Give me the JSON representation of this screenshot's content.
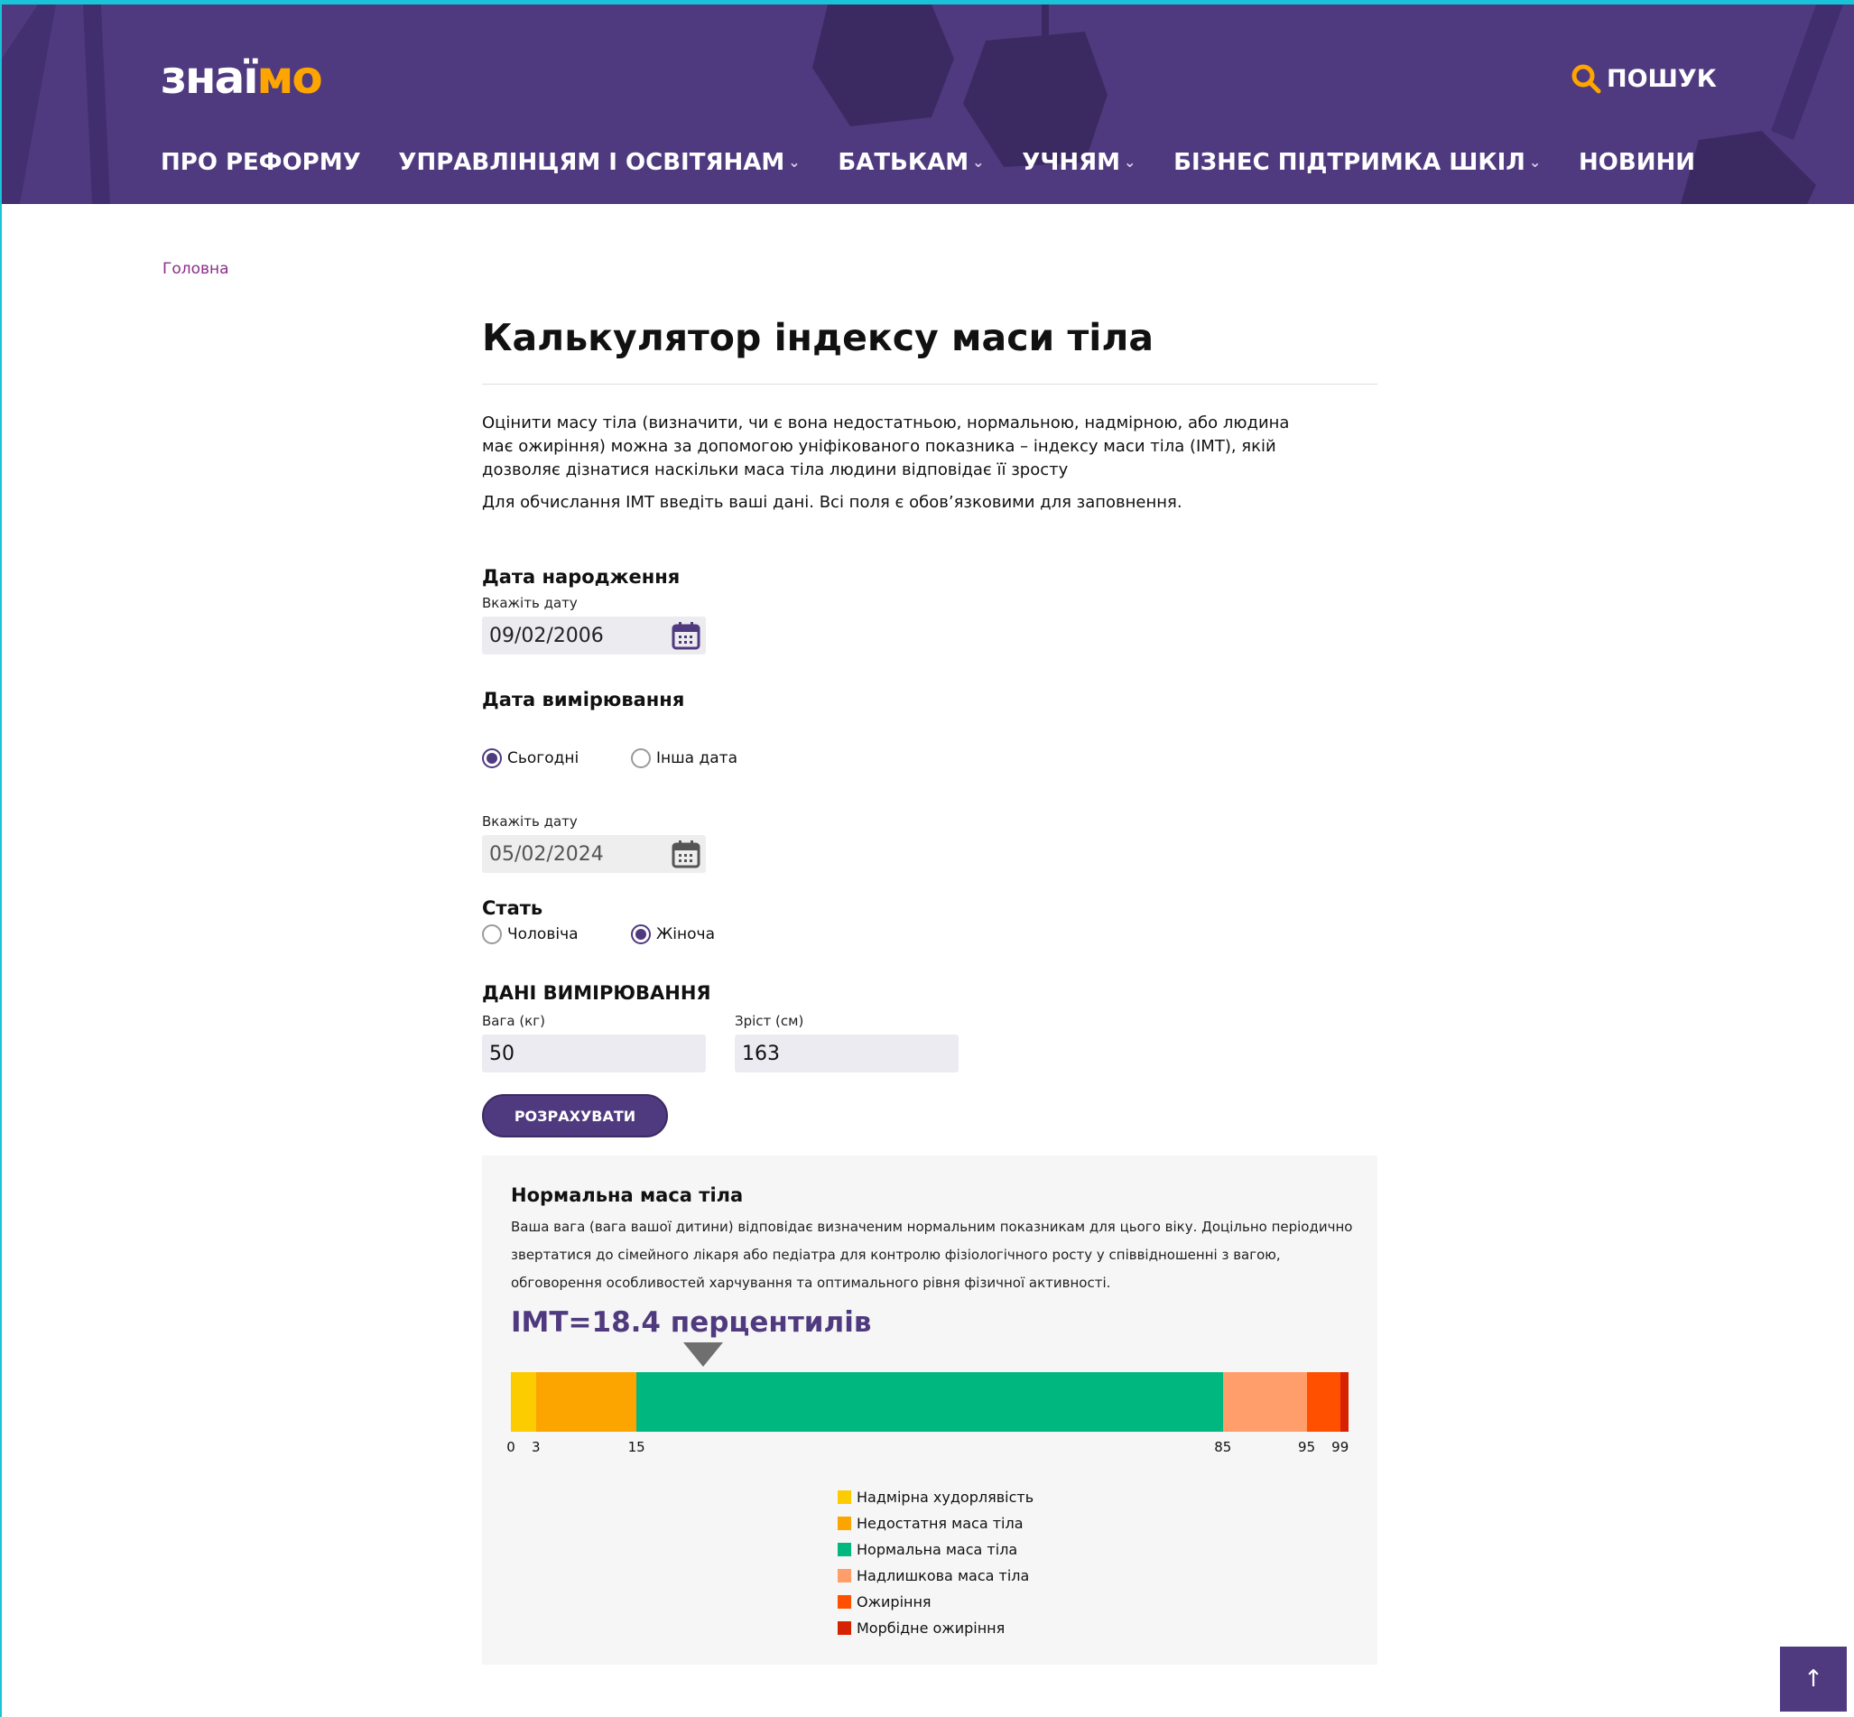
{
  "brand": {
    "logo_part1": "знаї",
    "logo_part2": "мо",
    "accent_color": "#ffa500",
    "header_color": "#4f3a7f"
  },
  "header": {
    "search_label": "ПОШУК",
    "search_icon": "search-icon",
    "nav": [
      {
        "label": "ПРО РЕФОРМУ",
        "has_dropdown": false
      },
      {
        "label": "УПРАВЛІНЦЯМ І ОСВІТЯНАМ",
        "has_dropdown": true
      },
      {
        "label": "БАТЬКАМ",
        "has_dropdown": true
      },
      {
        "label": "УЧНЯМ",
        "has_dropdown": true
      },
      {
        "label": "БІЗНЕС ПІДТРИМКА ШКІЛ",
        "has_dropdown": true
      },
      {
        "label": "НОВИНИ",
        "has_dropdown": false
      }
    ],
    "dropdown_glyph": "⌄"
  },
  "breadcrumb": {
    "home": "Головна"
  },
  "page": {
    "title": "Калькулятор індексу маси тіла",
    "intro": "Оцінити масу тіла (визначити, чи є вона недостатньою, нормальною, надмірною, або людина має ожиріння) можна за допомогою уніфікованого показника – індексу маси тіла (ІМТ), якій дозволяє дізнатися наскільки маса тіла людини відповідає її зросту",
    "instruction": "Для обчислання ІМТ введіть ваші дані. Всі поля є обов’язковими для заповнення."
  },
  "form": {
    "birth": {
      "title": "Дата народження",
      "label": "Вкажіть дату",
      "value": "09/02/2006"
    },
    "measure_date": {
      "title": "Дата вимірювання",
      "options": [
        {
          "label": "Сьогодні",
          "selected": true
        },
        {
          "label": "Інша дата",
          "selected": false
        }
      ],
      "label": "Вкажіть дату",
      "value": "05/02/2024"
    },
    "sex": {
      "title": "Стать",
      "options": [
        {
          "label": "Чоловіча",
          "selected": false
        },
        {
          "label": "Жіноча",
          "selected": true
        }
      ]
    },
    "measurements": {
      "title": "ДАНІ ВИМІРЮВАННЯ",
      "weight_label": "Вага (кг)",
      "weight_value": "50",
      "height_label": "Зріст (см)",
      "height_value": "163"
    },
    "submit_label": "РОЗРАХУВАТИ"
  },
  "result": {
    "title": "Нормальна маса тіла",
    "description": "Ваша вага (вага вашої дитини) відповідає визначеним нормальним показникам для цього віку. Доцільно періодично звертатися до сімейного лікаря або педіатра для контролю фізіологічного росту у співвідношенні з вагою, обговорення особливостей харчування та оптимального рівня фізичної активності.",
    "bmi_text": "ІМТ=18.4 перцентилів",
    "pointer_percentile": 23
  },
  "chart_data": {
    "type": "bar",
    "orientation": "horizontal-stacked-scale",
    "ticks": [
      "0",
      "3",
      "15",
      "85",
      "95",
      "99"
    ],
    "xlim": [
      0,
      100
    ],
    "segments": [
      {
        "name": "Надмірна худорлявість",
        "from": 0,
        "to": 3,
        "color": "#fccb00"
      },
      {
        "name": "Недостатня маса тіла",
        "from": 3,
        "to": 15,
        "color": "#fca500"
      },
      {
        "name": "Нормальна маса тіла",
        "from": 15,
        "to": 85,
        "color": "#00b87f"
      },
      {
        "name": "Надлишкова маса тіла",
        "from": 85,
        "to": 95,
        "color": "#ff9e6b"
      },
      {
        "name": "Ожиріння",
        "from": 95,
        "to": 99,
        "color": "#ff5000"
      },
      {
        "name": "Морбідне ожиріння",
        "from": 99,
        "to": 100,
        "color": "#d62200"
      }
    ],
    "marker_percentile": 23
  },
  "back_to_top": "↑"
}
